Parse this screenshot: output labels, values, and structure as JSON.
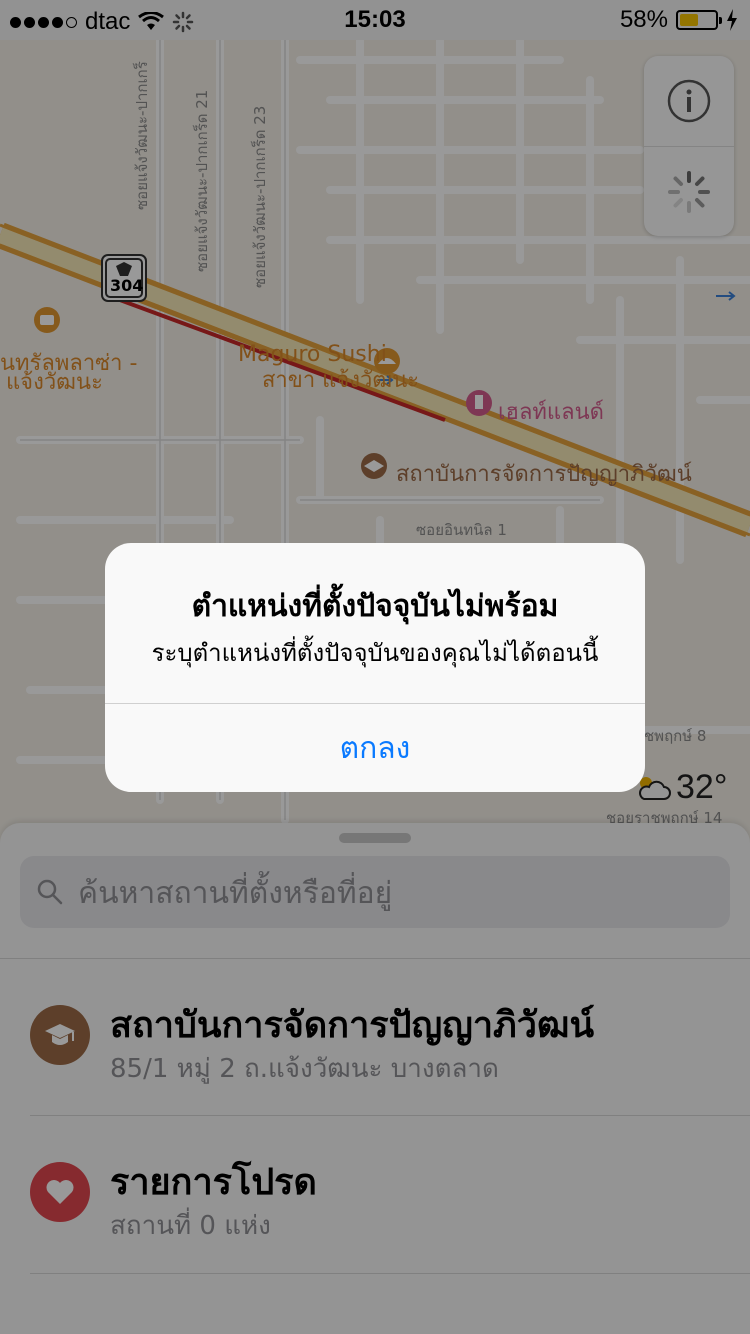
{
  "status_bar": {
    "carrier": "dtac",
    "time": "15:03",
    "battery": "58%",
    "battery_level": 0.58
  },
  "map": {
    "labels": {
      "road_number": "304",
      "poi_maguro_1": "Maguro Sushi",
      "poi_maguro_2": "สาขา แจ้งวัฒนะ",
      "poi_central_1": "นทรัลพลาซ่า -",
      "poi_central_2": "แจ้งวัฒนะ",
      "poi_health": "เฮลท์แลนด์",
      "poi_institute": "สถาบันการจัดการปัญญาภิวัฒน์",
      "street_inthanil": "ซอยอินทนิล 1",
      "street_vert_1": "ซอยแจ้งวัฒนะ-ปากเกร็",
      "street_vert_2": "ซอยแจ้งวัฒนะ-ปากเกร็ด 21",
      "street_vert_3": "ซอยแจ้งวัฒนะ-ปากเกร็ด 23",
      "street_phruksa_8": "ชพฤกษ์ 8",
      "street_phruksa_14": "ชอยราชพฤกษ์ 14"
    }
  },
  "weather": {
    "temperature": "32°",
    "icon": "cloud-sun-icon"
  },
  "search": {
    "placeholder": "ค้นหาสถานที่ตั้งหรือที่อยู่"
  },
  "list": [
    {
      "title": "สถาบันการจัดการปัญญาภิวัฒน์",
      "subtitle": "85/1 หมู่ 2 ถ.แจ้งวัฒนะ บางตลาด",
      "icon": "graduation-cap-icon",
      "color": "#9b6a46"
    },
    {
      "title": "รายการโปรด",
      "subtitle": "สถานที่ 0 แห่ง",
      "icon": "heart-icon",
      "color": "#e0474f"
    }
  ],
  "alert": {
    "title": "ตำแหน่งที่ตั้งปัจจุบันไม่พร้อม",
    "message": "ระบุตำแหน่งที่ตั้งปัจจุบันของคุณไม่ได้ตอนนี้",
    "button": "ตกลง"
  },
  "colors": {
    "accent": "#0a7aff",
    "road_main": "#e5a23c",
    "road_traffic": "#c62828"
  }
}
